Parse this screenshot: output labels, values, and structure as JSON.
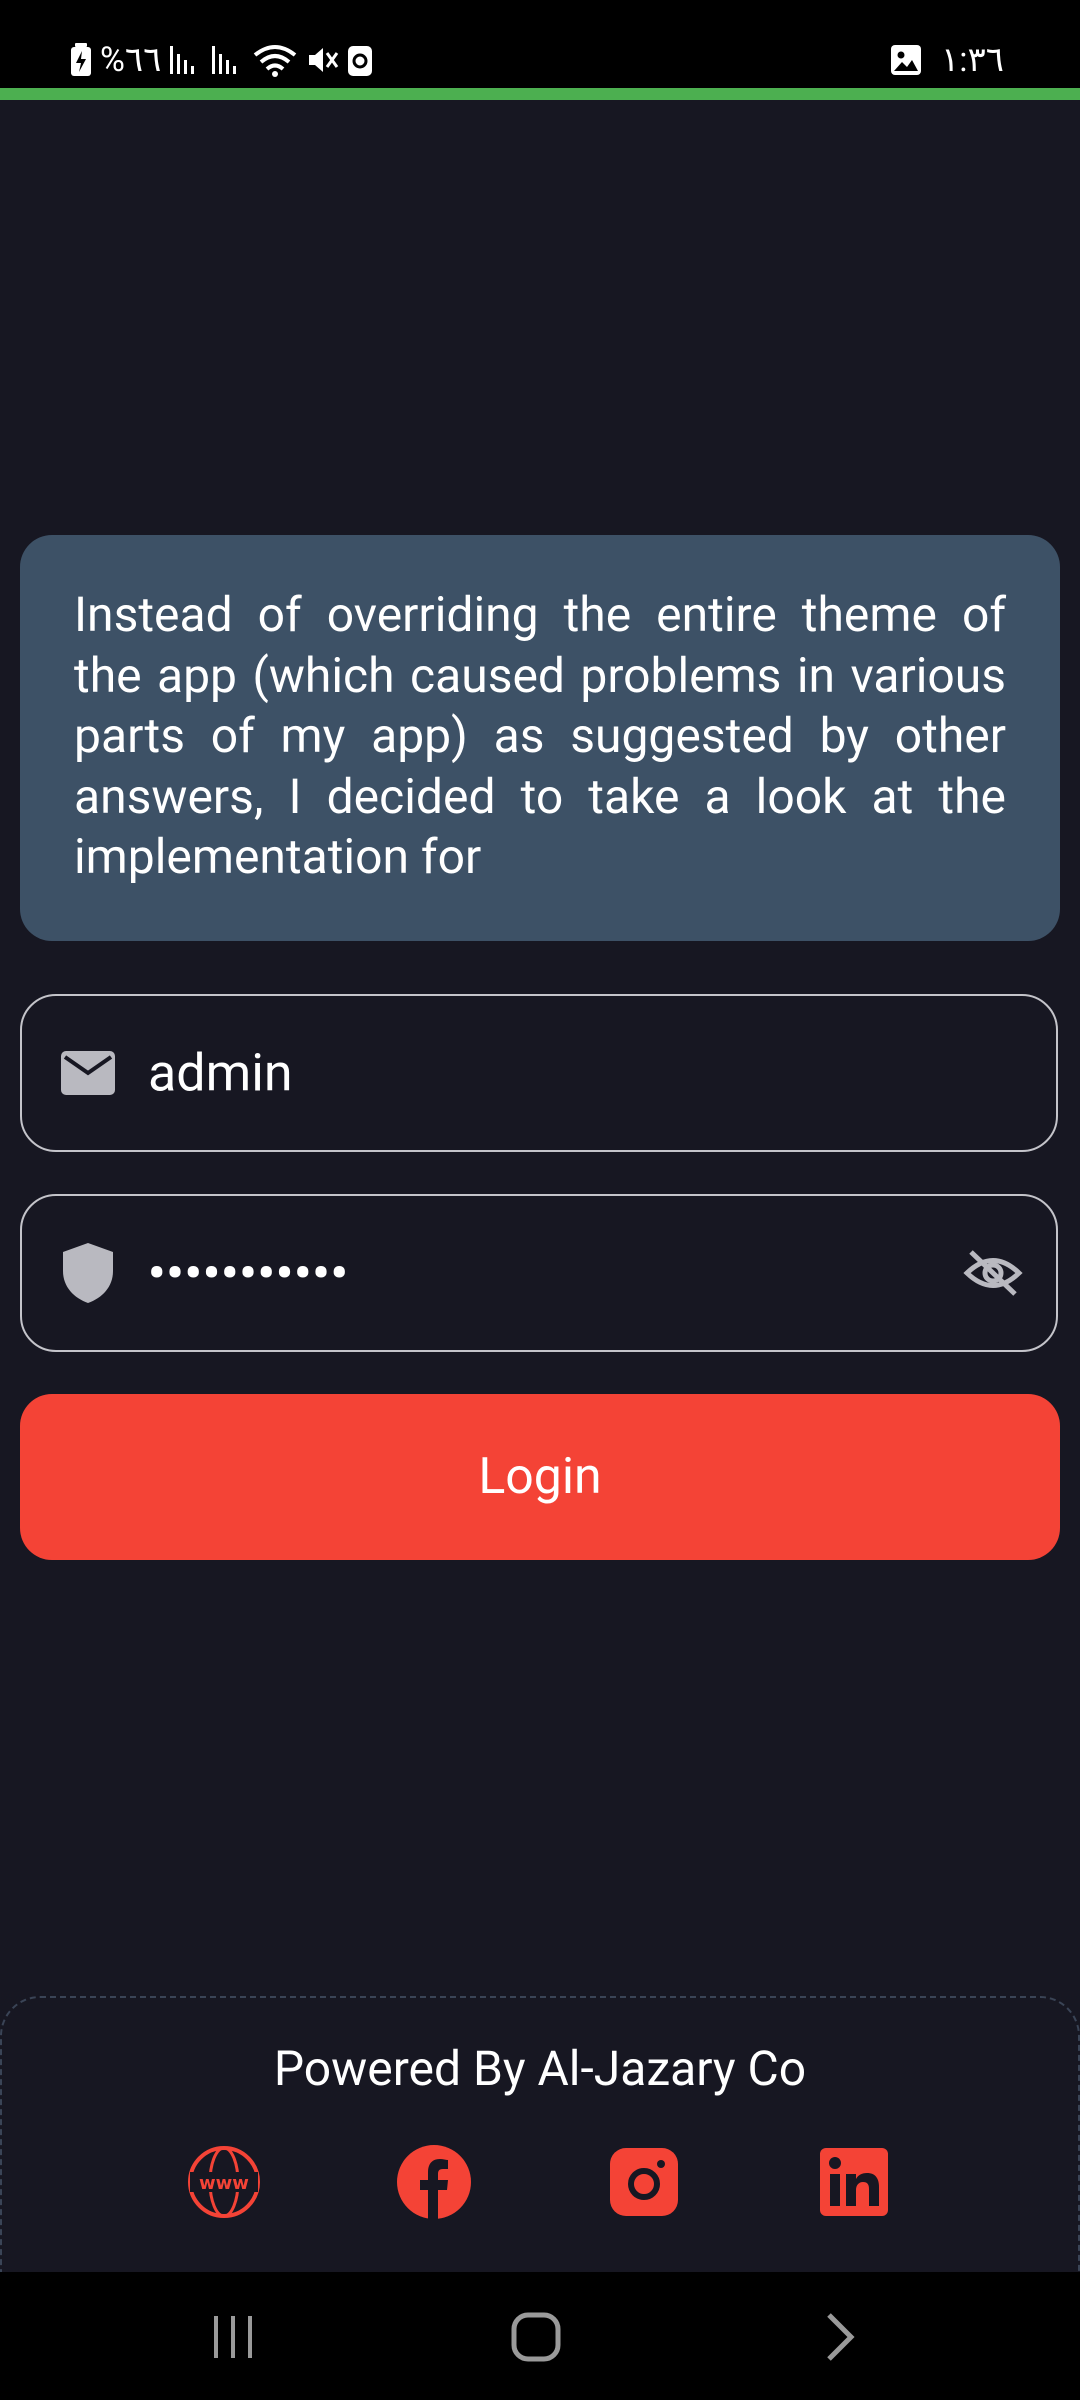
{
  "status_bar": {
    "battery_percent": "%٦٦",
    "time": "١:٣٦"
  },
  "info_card": {
    "text": "Instead of overriding the entire theme of the app (which caused problems in various parts of my app) as suggested by other answers, I decided to take a look at the implementation for"
  },
  "username_field": {
    "value": "admin",
    "icon": "envelope-icon"
  },
  "password_field": {
    "masked_value": "•••••••••••",
    "icon": "shield-icon",
    "toggle_icon": "eye-off-icon"
  },
  "login_button": {
    "label": "Login"
  },
  "footer": {
    "title": "Powered By Al-Jazary Co",
    "social_icons": [
      "www-icon",
      "facebook-icon",
      "instagram-icon",
      "linkedin-icon"
    ]
  },
  "colors": {
    "background": "#171722",
    "card": "#3D5166",
    "accent": "#F44336",
    "progress": "#4CAF50"
  }
}
